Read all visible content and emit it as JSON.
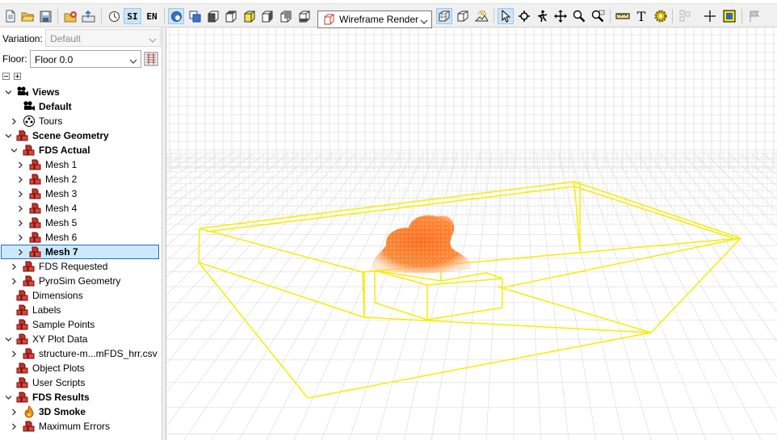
{
  "toolbar": {
    "si_label": "SI",
    "en_label": "EN",
    "render_mode": "Wireframe Render",
    "text_tool_label": "T"
  },
  "sidebar": {
    "variation_label": "Variation:",
    "variation_value": "Default",
    "floor_label": "Floor:",
    "floor_value": "Floor 0.0"
  },
  "tree": [
    {
      "label": "Views",
      "bold": true,
      "expanded": true
    },
    {
      "label": "Default",
      "bold": true
    },
    {
      "label": "Tours",
      "bold": false,
      "expanded": false
    },
    {
      "label": "Scene Geometry",
      "bold": true,
      "expanded": true
    },
    {
      "label": "FDS Actual",
      "bold": true,
      "expanded": true
    },
    {
      "label": "Mesh 1",
      "bold": false,
      "expanded": false
    },
    {
      "label": "Mesh 2",
      "bold": false,
      "expanded": false
    },
    {
      "label": "Mesh 3",
      "bold": false,
      "expanded": false
    },
    {
      "label": "Mesh 4",
      "bold": false,
      "expanded": false
    },
    {
      "label": "Mesh 5",
      "bold": false,
      "expanded": false
    },
    {
      "label": "Mesh 6",
      "bold": false,
      "expanded": false
    },
    {
      "label": "Mesh 7",
      "bold": true,
      "expanded": false,
      "selected": true
    },
    {
      "label": "FDS Requested",
      "bold": false,
      "expanded": false
    },
    {
      "label": "PyroSim Geometry",
      "bold": false,
      "expanded": false
    },
    {
      "label": "Dimensions",
      "bold": false
    },
    {
      "label": "Labels",
      "bold": false
    },
    {
      "label": "Sample Points",
      "bold": false
    },
    {
      "label": "XY Plot Data",
      "bold": false,
      "expanded": true
    },
    {
      "label": "structure-m...mFDS_hrr.csv",
      "bold": false,
      "expanded": false
    },
    {
      "label": "Object Plots",
      "bold": false
    },
    {
      "label": "User Scripts",
      "bold": false
    },
    {
      "label": "FDS Results",
      "bold": true,
      "expanded": true
    },
    {
      "label": "3D Smoke",
      "bold": true,
      "expanded": false
    },
    {
      "label": "Maximum Errors",
      "bold": false,
      "expanded": false
    }
  ],
  "colors": {
    "wireframe": "#f5ee00",
    "grid": "#d8d8d8",
    "fire": "#ff7a2a",
    "selection": "#cce8ff"
  }
}
